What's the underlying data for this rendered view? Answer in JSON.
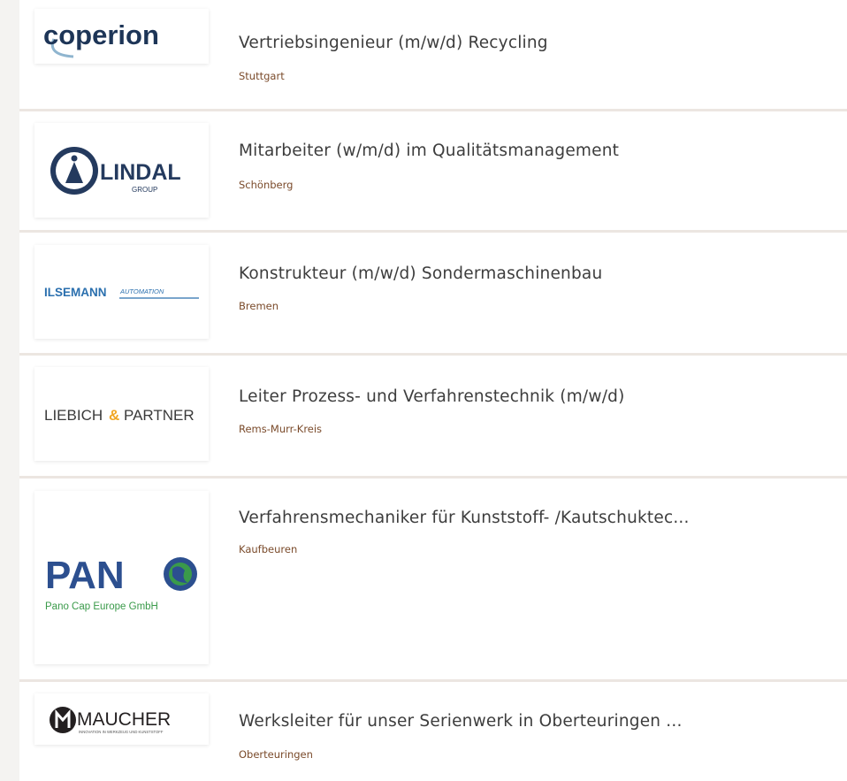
{
  "jobs": [
    {
      "title": "Vertriebsingenieur (m/w/d) Recycling",
      "location": "Stuttgart",
      "company": "coperion",
      "logo": {
        "wordmark": "coperion"
      }
    },
    {
      "title": "Mitarbeiter (w/m/d) im Qualitätsmanagement",
      "location": "Schönberg",
      "company": "LINDAL GROUP",
      "logo": {
        "wordmark": "LINDAL",
        "sub": "GROUP"
      }
    },
    {
      "title": "Konstrukteur (m/w/d) Sondermaschinenbau",
      "location": "Bremen",
      "company": "ILSEMANN AUTOMATION",
      "logo": {
        "wordmark": "ILSEMANN",
        "sub": "AUTOMATION"
      }
    },
    {
      "title": "Leiter Prozess- und Verfahrenstechnik (m/w/d)",
      "location": "Rems-Murr-Kreis",
      "company": "LIEBICH & PARTNER",
      "logo": {
        "left": "LIEBICH",
        "amp": "&",
        "right": "PARTNER"
      }
    },
    {
      "title": "Verfahrensmechaniker für Kunststoff- /Kautschuktec...",
      "location": "Kaufbeuren",
      "company": "Pano Cap Europe GmbH",
      "logo": {
        "wordmark": "PAN",
        "sub": "Pano Cap Europe GmbH"
      }
    },
    {
      "title": "Werksleiter für unser Serienwerk in Oberteuringen ...",
      "location": "Oberteuringen",
      "company": "MAUCHER",
      "logo": {
        "wordmark": "MAUCHER",
        "sub": "INNOVATION IN WERKZEUG UND KUNSTSTOFF"
      }
    }
  ],
  "colors": {
    "title": "#3d3d3d",
    "location": "#7a4a2a",
    "divider": "#ece6e1",
    "coperion": "#1d3557",
    "lindal": "#243a5e",
    "ilsemann": "#2a6fae",
    "liebich_amp": "#f0a623",
    "pano_blue": "#2c4f8f",
    "pano_green": "#3a9a4a",
    "maucher": "#231f20"
  }
}
